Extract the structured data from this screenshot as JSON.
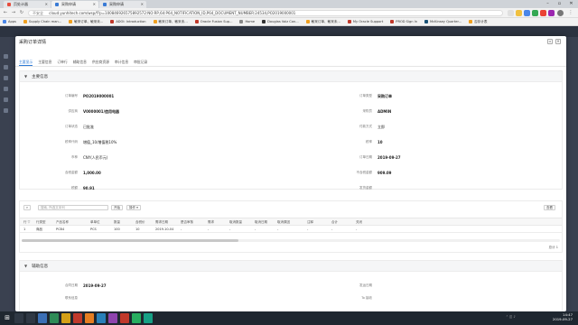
{
  "browser": {
    "tabs": [
      {
        "title": "页处计器",
        "active": false
      },
      {
        "title": "采购申请",
        "active": true
      },
      {
        "title": "采购申请",
        "active": false
      }
    ],
    "url_security": "不安全",
    "url": "cloud.yunhitech.com/wsp/f?p=100846926575892572:NO:RP,64:P64_NOTIFICATION_ID,P64_DOCUMENT_NUMBER:24534,PO2019000001"
  },
  "bookmarks": [
    {
      "label": "Apps",
      "color": "#4a86e8"
    },
    {
      "label": "Supply Chain man...",
      "color": "#f0a020"
    },
    {
      "label": "敏采订单、敏采未...",
      "color": "#f0a020"
    },
    {
      "label": "ADOI: Introduction",
      "color": "#c0392b"
    },
    {
      "label": "敏采订单、敏采未...",
      "color": "#f0a020"
    },
    {
      "label": "Oracle Fusion Sup...",
      "color": "#c0392b"
    },
    {
      "label": "Home",
      "color": "#888888"
    },
    {
      "label": "Douglas Volz Con...",
      "color": "#333333"
    },
    {
      "label": "敏采订单、敏采未...",
      "color": "#f0a020"
    },
    {
      "label": "My Oracle Support",
      "color": "#c0392b"
    },
    {
      "label": "PROD Sign In",
      "color": "#c0392b"
    },
    {
      "label": "McKinsey Quarter...",
      "color": "#1a5276"
    },
    {
      "label": "否存计表",
      "color": "#f0a020"
    }
  ],
  "modal": {
    "title": "采购订单详情",
    "tabs": [
      "主要显示",
      "主要信息",
      "订单行",
      "辅助信息",
      "供应商资源",
      "审计信息",
      "审批记录"
    ],
    "active_tab": 0
  },
  "main_section": {
    "title": "主要信息",
    "left_fields": [
      {
        "label": "订单编号",
        "value": "PO2019000001",
        "bold": true
      },
      {
        "label": "供应商",
        "value": "V0000001/信用电器",
        "bold": true
      },
      {
        "label": "订单状态",
        "value": "已批准",
        "bold": false
      },
      {
        "label": "税率代码",
        "value": "增值_10/增值税10%",
        "bold": false
      },
      {
        "label": "币种",
        "value": "CNY(人民币元)",
        "bold": false
      },
      {
        "label": "含税金额",
        "value": "1,000.00",
        "bold": true
      },
      {
        "label": "税额",
        "value": "90.91",
        "bold": true
      }
    ],
    "right_fields": [
      {
        "label": "订单类型",
        "value": "采购订单",
        "bold": true
      },
      {
        "label": "采购员",
        "value": "ADMIN",
        "bold": true
      },
      {
        "label": "付款方式",
        "value": "立即",
        "bold": false
      },
      {
        "label": "税率",
        "value": "10",
        "bold": true
      },
      {
        "label": "订单日期",
        "value": "2019-09-27",
        "bold": true
      },
      {
        "label": "不含税金额",
        "value": "909.09",
        "bold": true
      },
      {
        "label": "发货金额",
        "value": "",
        "bold": false
      }
    ]
  },
  "lines": {
    "search_placeholder": "搜索, 所选文本列",
    "search_btn": "开始",
    "actions_btn": "操作 ▾",
    "right_btn": "查看",
    "columns": [
      "行 ▽",
      "行类型",
      "产品名称",
      "单单位",
      "数量",
      "含税价",
      "需求日期",
      "是否审核",
      "需求",
      "取消数量",
      "取消日期",
      "取消原因",
      "注释",
      "合计",
      "关闭"
    ],
    "rows": [
      [
        "1",
        "商品",
        "PCB4",
        "PCS",
        "100",
        "10",
        "2019-10-04",
        "-",
        "-",
        "-",
        "-",
        "-",
        "-",
        "-",
        "-"
      ]
    ],
    "total": "总计 1"
  },
  "aux_section": {
    "title": "辅助信息",
    "left_fields": [
      {
        "label": "合同日期",
        "value": "2019-09-27",
        "bold": true
      },
      {
        "label": "联系信息",
        "value": "",
        "bold": false
      }
    ],
    "right_fields": [
      {
        "label": "发运日期",
        "value": "",
        "bold": false
      },
      {
        "label": "To 接收",
        "value": "",
        "bold": false
      }
    ]
  },
  "taskbar": {
    "time": "14:47",
    "date": "2019-09-27"
  }
}
